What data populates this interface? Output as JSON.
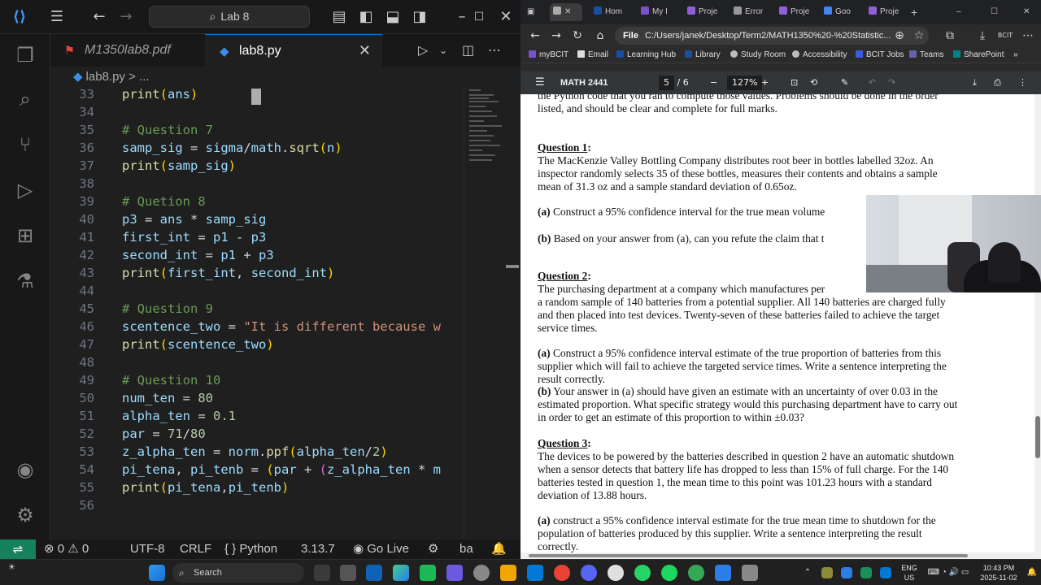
{
  "vscode": {
    "search_label": "Lab 8",
    "tabs": [
      {
        "label": "M1350lab8.pdf"
      },
      {
        "label": "lab8.py"
      }
    ],
    "breadcrumb": {
      "file": "lab8.py",
      "more": "> ..."
    },
    "lines": [
      {
        "num": "33"
      },
      {
        "num": "34"
      },
      {
        "num": "35"
      },
      {
        "num": "36"
      },
      {
        "num": "37"
      },
      {
        "num": "38"
      },
      {
        "num": "39"
      },
      {
        "num": "40"
      },
      {
        "num": "41"
      },
      {
        "num": "42"
      },
      {
        "num": "43"
      },
      {
        "num": "44"
      },
      {
        "num": "45"
      },
      {
        "num": "46"
      },
      {
        "num": "47"
      },
      {
        "num": "48"
      },
      {
        "num": "49"
      },
      {
        "num": "50"
      },
      {
        "num": "51"
      },
      {
        "num": "52"
      },
      {
        "num": "53"
      },
      {
        "num": "54"
      },
      {
        "num": "55"
      },
      {
        "num": "56"
      }
    ],
    "code": {
      "l33": {
        "a": "print",
        "b": "(",
        "c": "ans",
        "d": ")"
      },
      "l35": "# Question 7",
      "l36": {
        "a": "samp_sig",
        "b": " = ",
        "c": "sigma",
        "d": "/",
        "e": "math",
        "f": ".",
        "g": "sqrt",
        "h": "(",
        "i": "n",
        "j": ")"
      },
      "l37": {
        "a": "print",
        "b": "(",
        "c": "samp_sig",
        "d": ")"
      },
      "l39": "# Quetion 8",
      "l40": {
        "a": "p3",
        "b": " = ",
        "c": "ans",
        "d": " * ",
        "e": "samp_sig"
      },
      "l41": {
        "a": "first_int",
        "b": " = ",
        "c": "p1",
        "d": " - ",
        "e": "p3"
      },
      "l42": {
        "a": "second_int",
        "b": " = ",
        "c": "p1",
        "d": " + ",
        "e": "p3"
      },
      "l43": {
        "a": "print",
        "b": "(",
        "c": "first_int",
        "d": ", ",
        "e": "second_int",
        "f": ")"
      },
      "l45": "# Question 9",
      "l46": {
        "a": "scentence_two",
        "b": " = ",
        "c": "\"It is different because w"
      },
      "l47": {
        "a": "print",
        "b": "(",
        "c": "scentence_two",
        "d": ")"
      },
      "l49": "# Question 10",
      "l50": {
        "a": "num_ten",
        "b": " = ",
        "c": "80"
      },
      "l51": {
        "a": "alpha_ten",
        "b": " = ",
        "c": "0.1"
      },
      "l52": {
        "a": "par",
        "b": " = ",
        "c": "71",
        "d": "/",
        "e": "80"
      },
      "l53": {
        "a": "z_alpha_ten",
        "b": " = ",
        "c": "norm",
        "d": ".",
        "e": "ppf",
        "f": "(",
        "g": "alpha_ten",
        "h": "/",
        "i": "2",
        "j": ")"
      },
      "l54": {
        "a": "pi_tena",
        "b": ", ",
        "c": "pi_tenb",
        "d": " = ",
        "e": "(",
        "f": "par",
        "g": " + ",
        "h": "(",
        "i": "z_alpha_ten",
        "j": " * ",
        "k": "m"
      },
      "l55": {
        "a": "print",
        "b": "(",
        "c": "pi_tena",
        "d": ",",
        "e": "pi_tenb",
        "f": ")"
      }
    },
    "status": {
      "errors": "0",
      "warnings": "0",
      "encoding": "UTF-8",
      "eol": "CRLF",
      "language": "{ } Python",
      "version": "3.13.7",
      "golive": "Go Live",
      "extra": "ba"
    }
  },
  "browser": {
    "tabs": [
      {
        "label": "Hom"
      },
      {
        "label": "My I"
      },
      {
        "label": "Proje"
      },
      {
        "label": "Error"
      },
      {
        "label": "Proje"
      },
      {
        "label": "Goo"
      },
      {
        "label": "Proje"
      }
    ],
    "address": {
      "scheme": "File",
      "url": "C:/Users/janek/Desktop/Term2/MATH1350%20-%20Statistic..."
    },
    "favorites": [
      {
        "label": "myBCIT"
      },
      {
        "label": "Email"
      },
      {
        "label": "Learning Hub"
      },
      {
        "label": "Library"
      },
      {
        "label": "Study Room"
      },
      {
        "label": "Accessibility"
      },
      {
        "label": "BCIT Jobs"
      },
      {
        "label": "Teams"
      },
      {
        "label": "SharePoint"
      }
    ],
    "pdf": {
      "title": "MATH 2441",
      "page_current": "5",
      "page_total": "/ 6",
      "zoom": "127%",
      "lines": {
        "top1": "the Python code that you ran to compute those values.  Problems should be done in the order",
        "top2": "listed, and should be clear and complete for full marks.",
        "q1h": "Question 1",
        "q1a": "The MacKenzie Valley Bottling Company distributes root beer in bottles labelled 32oz.  An",
        "q1b": "inspector randomly selects 35 of these bottles, measures their contents and obtains a sample",
        "q1c": "mean of 31.3 oz and a sample standard deviation of 0.65oz.",
        "q1pa_tag": "(a)",
        "q1pa": " Construct a 95% confidence interval for the true mean volume",
        "q1pb_tag": "(b)",
        "q1pb": " Based on your answer from (a), can you refute the claim that t",
        "q2h": "Question 2",
        "q2a": "The purchasing department at a company which manufactures per",
        "q2b": "a random sample of 140 batteries from a potential supplier.  All 140 batteries are charged fully",
        "q2c": "and then placed into test devices.  Twenty-seven of these batteries failed to achieve the target",
        "q2d": "service times.",
        "q2pa_tag": "(a)",
        "q2pa1": " Construct a 95% confidence interval estimate of the true proportion of batteries from this",
        "q2pa2": "supplier which will fail to achieve the targeted service times.  Write a sentence interpreting the",
        "q2pa3": "result correctly.",
        "q2pb_tag": "(b)",
        "q2pb1": " Your answer in (a) should have given an estimate with an uncertainty of over 0.03 in the",
        "q2pb2": "estimated proportion.  What specific strategy would this purchasing department have to carry out",
        "q2pb3": "in order to get an estimate of this proportion to within ±0.03?",
        "q3h": "Question 3",
        "q3a": "The devices to be powered by the batteries described in question 2 have an automatic shutdown",
        "q3b": "when a sensor detects that battery life has dropped to less than 15% of full charge.  For the 140",
        "q3c": "batteries tested in question 1, the mean time to this point was 101.23 hours with a standard",
        "q3d": "deviation of 13.88 hours.",
        "q3pa_tag": "(a)",
        "q3pa1": " construct a 95% confidence interval estimate for the true mean time to shutdown for the",
        "q3pa2": "population of batteries produced by this supplier.  Write a sentence interpreting the result",
        "q3pa3": "correctly."
      }
    }
  },
  "taskbar": {
    "search_placeholder": "Search",
    "lang": "ENG",
    "region": "US",
    "time": "10:43 PM",
    "date": "2025-11-02"
  },
  "colors": {
    "vscode_bg": "#1f1f1f",
    "accent": "#0078d4",
    "remote": "#16825d"
  }
}
